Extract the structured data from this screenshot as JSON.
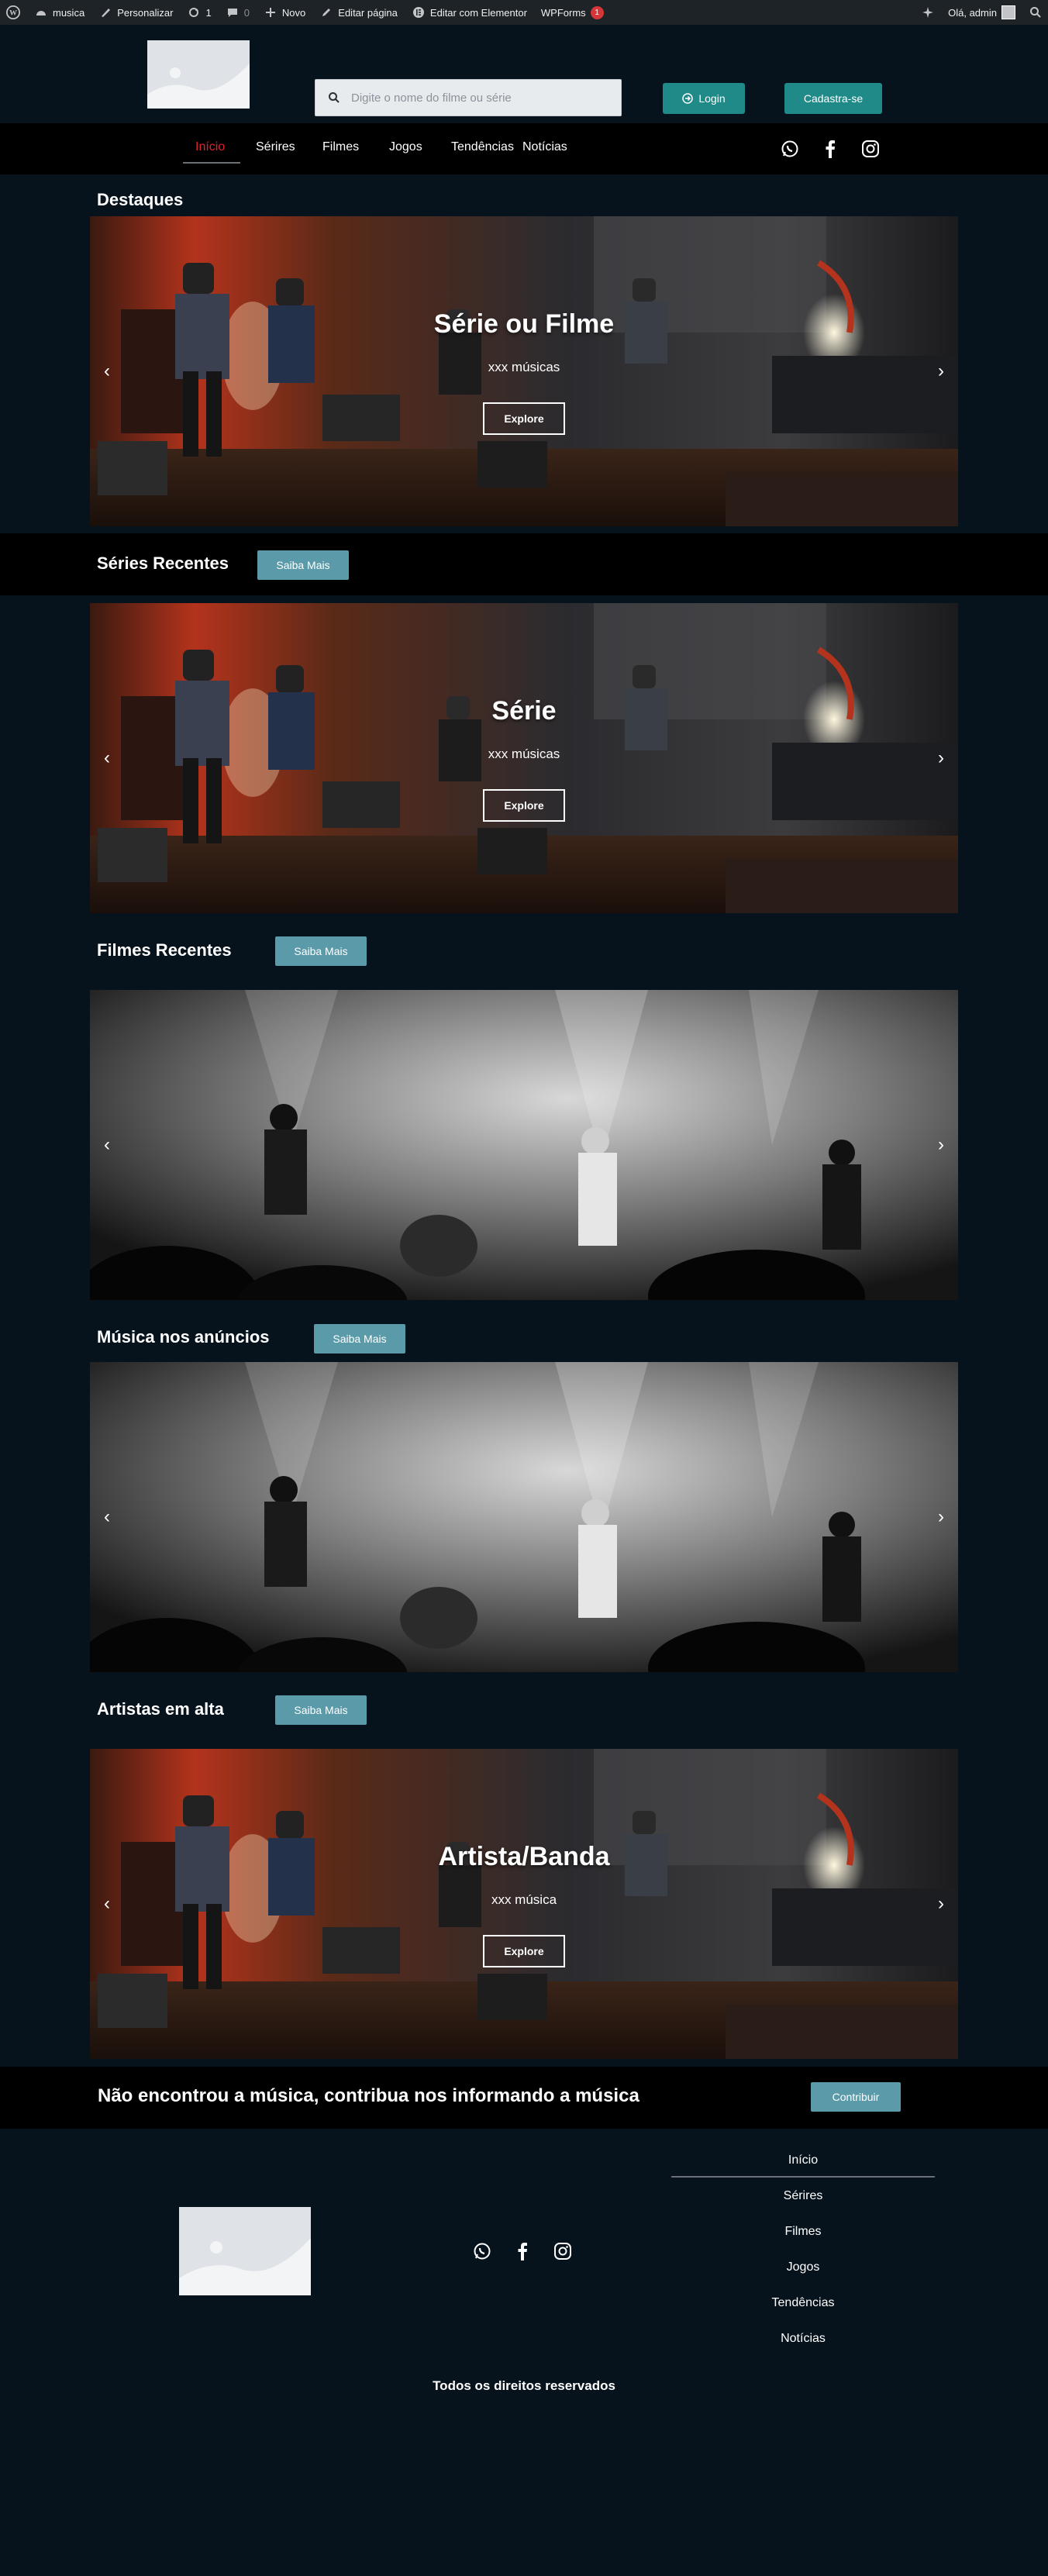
{
  "adminbar": {
    "site_name": "musica",
    "customize": "Personalizar",
    "updates_count": "1",
    "comments_count": "0",
    "new_label": "Novo",
    "edit_page": "Editar página",
    "edit_elementor": "Editar com Elementor",
    "wpforms": "WPForms",
    "wpforms_badge": "1",
    "greeting": "Olá, admin"
  },
  "header": {
    "search_placeholder": "Digite o nome do filme ou série",
    "login_label": "Login",
    "signup_label": "Cadastra-se"
  },
  "nav": {
    "items": [
      "Início",
      "Sérires",
      "Filmes",
      "Jogos",
      "Tendências",
      "Notícias"
    ],
    "active_color": "#e0232c"
  },
  "social_icons": [
    "whatsapp-icon",
    "facebook-icon",
    "instagram-icon"
  ],
  "sections": {
    "destaques": {
      "title": "Destaques",
      "slide": {
        "title": "Série ou Filme",
        "subtitle": "xxx músicas",
        "button": "Explore"
      }
    },
    "series": {
      "title": "Séries Recentes",
      "button": "Saiba Mais",
      "slide": {
        "title": "Série",
        "subtitle": "xxx músicas",
        "button": "Explore"
      }
    },
    "filmes": {
      "title": "Filmes Recentes",
      "button": "Saiba Mais"
    },
    "anuncios": {
      "title": "Música nos anúncios",
      "button": "Saiba Mais"
    },
    "artistas": {
      "title": "Artistas em alta",
      "button": "Saiba Mais",
      "slide": {
        "title": "Artista/Banda",
        "subtitle": "xxx música",
        "button": "Explore"
      }
    }
  },
  "contribute": {
    "text": "Não encontrou a música, contribua nos informando a música",
    "button": "Contribuir"
  },
  "footer": {
    "nav": [
      "Início",
      "Sérires",
      "Filmes",
      "Jogos",
      "Tendências",
      "Notícias"
    ],
    "copyright": "Todos os direitos reservados"
  },
  "colors": {
    "page_bg": "#06131c",
    "teal_button": "#1f8a88",
    "saiba_button": "#5b9aa9",
    "band_bg": "#000000"
  }
}
